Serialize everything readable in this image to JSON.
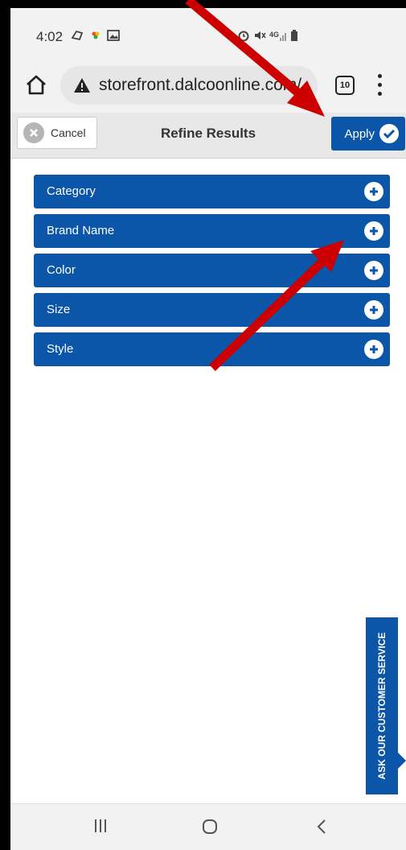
{
  "status_bar": {
    "time": "4:02"
  },
  "browser": {
    "url": "storefront.dalcoonline.com/",
    "tab_count": "10"
  },
  "filter_header": {
    "cancel_label": "Cancel",
    "title": "Refine Results",
    "apply_label": "Apply"
  },
  "filters": [
    {
      "label": "Category"
    },
    {
      "label": "Brand Name"
    },
    {
      "label": "Color"
    },
    {
      "label": "Size"
    },
    {
      "label": "Style"
    }
  ],
  "customer_service_tab": "ASK OUR CUSTOMER SERVICE",
  "colors": {
    "accent": "#0b56a8",
    "annotation_arrow": "#cc0000"
  }
}
